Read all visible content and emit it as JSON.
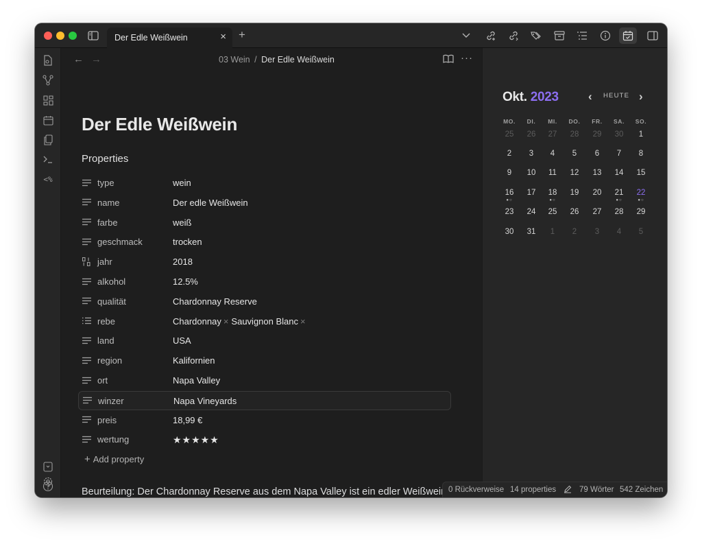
{
  "tab": {
    "title": "Der Edle Weißwein",
    "close": "×",
    "new_tab": "+"
  },
  "breadcrumb": {
    "folder": "03 Wein",
    "separator": "/",
    "current": "Der Edle Weißwein"
  },
  "note": {
    "title": "Der Edle Weißwein",
    "properties_heading": "Properties",
    "properties": [
      {
        "key": "type",
        "value": "wein",
        "icon": "text-lines-icon"
      },
      {
        "key": "name",
        "value": "Der edle Weißwein",
        "icon": "text-lines-icon"
      },
      {
        "key": "farbe",
        "value": "weiß",
        "icon": "text-lines-icon"
      },
      {
        "key": "geschmack",
        "value": "trocken",
        "icon": "text-lines-icon"
      },
      {
        "key": "jahr",
        "value": "2018",
        "icon": "number-icon"
      },
      {
        "key": "alkohol",
        "value": "12.5%",
        "icon": "text-lines-icon"
      },
      {
        "key": "qualität",
        "value": "Chardonnay Reserve",
        "icon": "text-lines-icon"
      },
      {
        "key": "rebe",
        "values": [
          "Chardonnay",
          "Sauvignon Blanc"
        ],
        "icon": "list-icon"
      },
      {
        "key": "land",
        "value": "USA",
        "icon": "text-lines-icon"
      },
      {
        "key": "region",
        "value": "Kalifornien",
        "icon": "text-lines-icon"
      },
      {
        "key": "ort",
        "value": "Napa Valley",
        "icon": "text-lines-icon"
      },
      {
        "key": "winzer",
        "value": "Napa Vineyards",
        "icon": "text-lines-icon"
      },
      {
        "key": "preis",
        "value": "18,99 €",
        "icon": "text-lines-icon"
      },
      {
        "key": "wertung",
        "value": "★★★★★",
        "icon": "text-lines-icon"
      }
    ],
    "add_property": "Add property",
    "pill_remove": "×",
    "body": "Beurteilung: Der Chardonnay Reserve aus dem Napa Valley ist ein edler Weißwein aus den USA. Er überzeugt durch seinen trockenen Geschmack und seine elegante Note. Dieser Wein eignet sich perfekt als Begleitung zu gehobenen"
  },
  "calendar": {
    "month": "Okt.",
    "year": "2023",
    "today_label": "HEUTE",
    "weekdays": [
      "MO.",
      "DI.",
      "MI.",
      "DO.",
      "FR.",
      "SA.",
      "SO."
    ],
    "weeks": [
      [
        "25",
        "26",
        "27",
        "28",
        "29",
        "30",
        "1"
      ],
      [
        "2",
        "3",
        "4",
        "5",
        "6",
        "7",
        "8"
      ],
      [
        "9",
        "10",
        "11",
        "12",
        "13",
        "14",
        "15"
      ],
      [
        "16",
        "17",
        "18",
        "19",
        "20",
        "21",
        "22"
      ],
      [
        "23",
        "24",
        "25",
        "26",
        "27",
        "28",
        "29"
      ],
      [
        "30",
        "31",
        "1",
        "2",
        "3",
        "4",
        "5"
      ]
    ],
    "dots": {
      "16": "●○",
      "18": "●○",
      "21": "●○",
      "22": "●○"
    },
    "today": "22",
    "accent_color": "#8c6ef0"
  },
  "status": {
    "backlinks": "0 Rückverweise",
    "properties": "14 properties",
    "words": "79 Wörter",
    "chars": "542 Zeichen"
  },
  "icons": {
    "titlebar": [
      "sidebar-toggle-icon",
      "chevron-down-icon",
      "link-add-icon",
      "link-icon",
      "tags-icon",
      "archive-icon",
      "outline-icon",
      "info-icon",
      "calendar-check-icon",
      "right-sidebar-icon"
    ],
    "ribbon": [
      "file-switcher-icon",
      "graph-icon",
      "canvas-icon",
      "calendar-icon",
      "copy-icon",
      "terminal-icon",
      "templater-icon",
      "vault-icon",
      "help-icon",
      "settings-icon"
    ]
  }
}
